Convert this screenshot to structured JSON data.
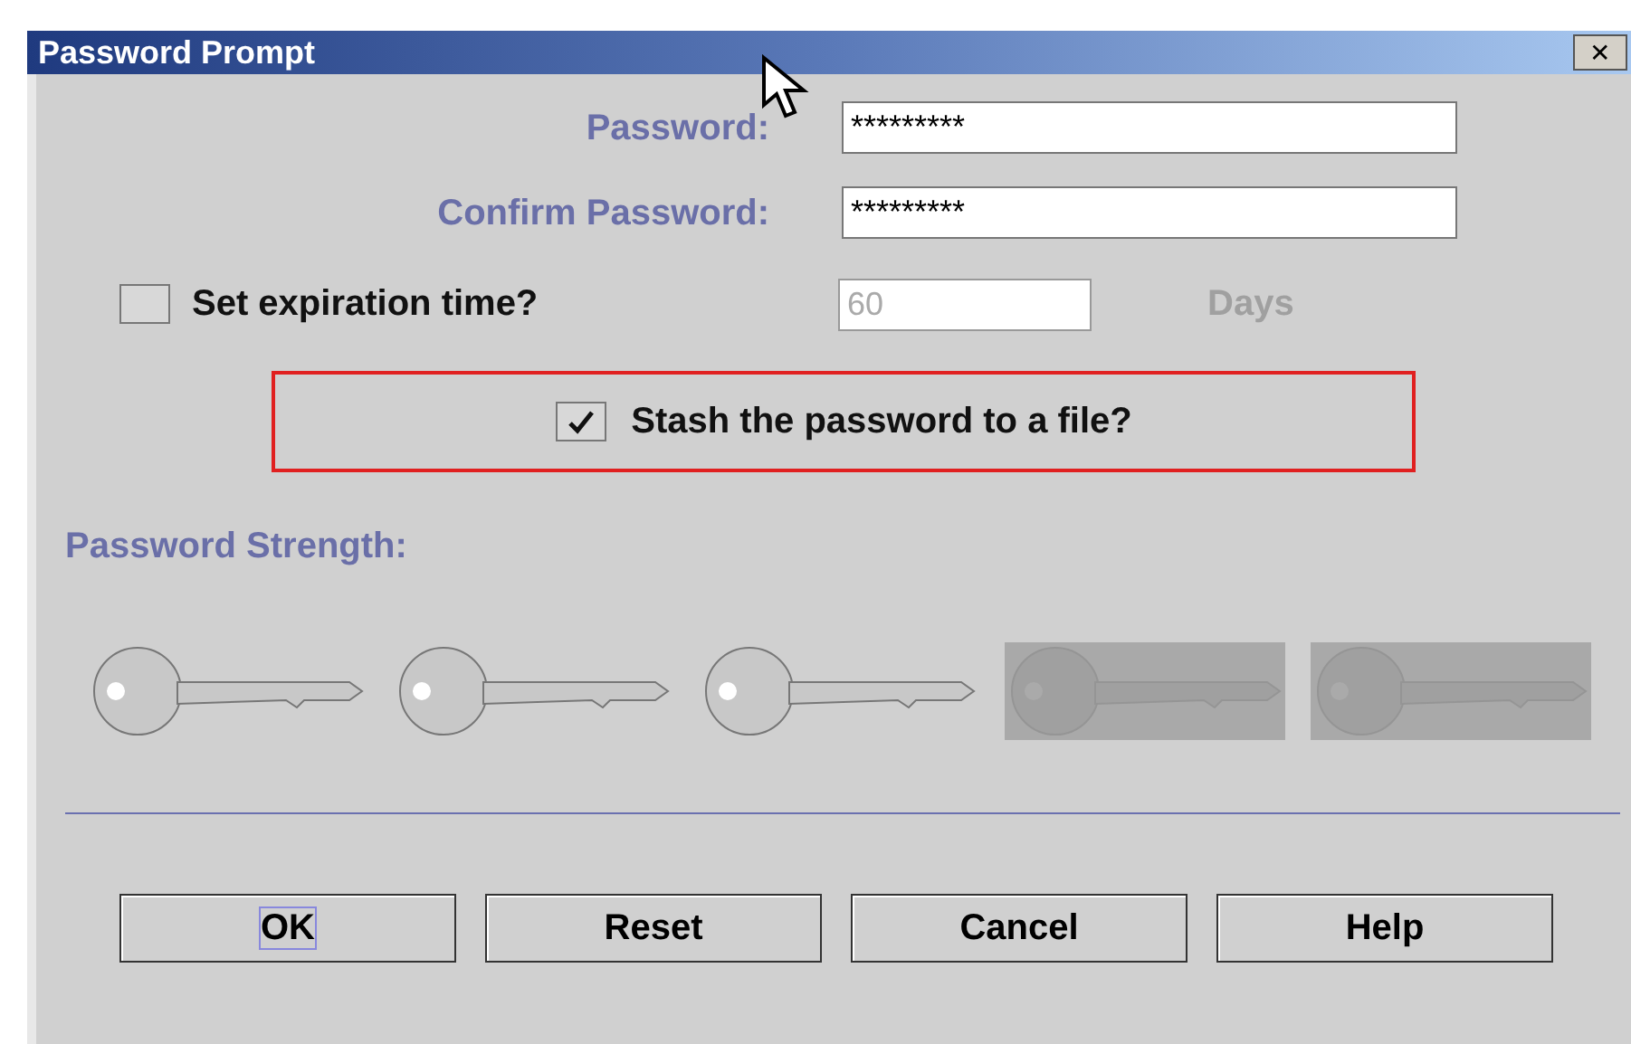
{
  "window": {
    "title": "Password Prompt",
    "close": "✕"
  },
  "fields": [
    {
      "label": "Password:",
      "value": "*********"
    },
    {
      "label": "Confirm Password:",
      "value": "*********"
    }
  ],
  "expiration": {
    "label": "Set expiration time?",
    "checked": false,
    "value": "60",
    "unit": "Days",
    "disabled": true
  },
  "stash": {
    "label": "Stash the password to a file?",
    "checked": true,
    "highlighted": true
  },
  "strength": {
    "label": "Password Strength:",
    "keys": [
      {
        "active": true
      },
      {
        "active": true
      },
      {
        "active": true
      },
      {
        "active": false
      },
      {
        "active": false
      }
    ]
  },
  "buttons": [
    {
      "label": "OK",
      "focused": true
    },
    {
      "label": "Reset",
      "focused": false
    },
    {
      "label": "Cancel",
      "focused": false
    },
    {
      "label": "Help",
      "focused": false
    }
  ]
}
